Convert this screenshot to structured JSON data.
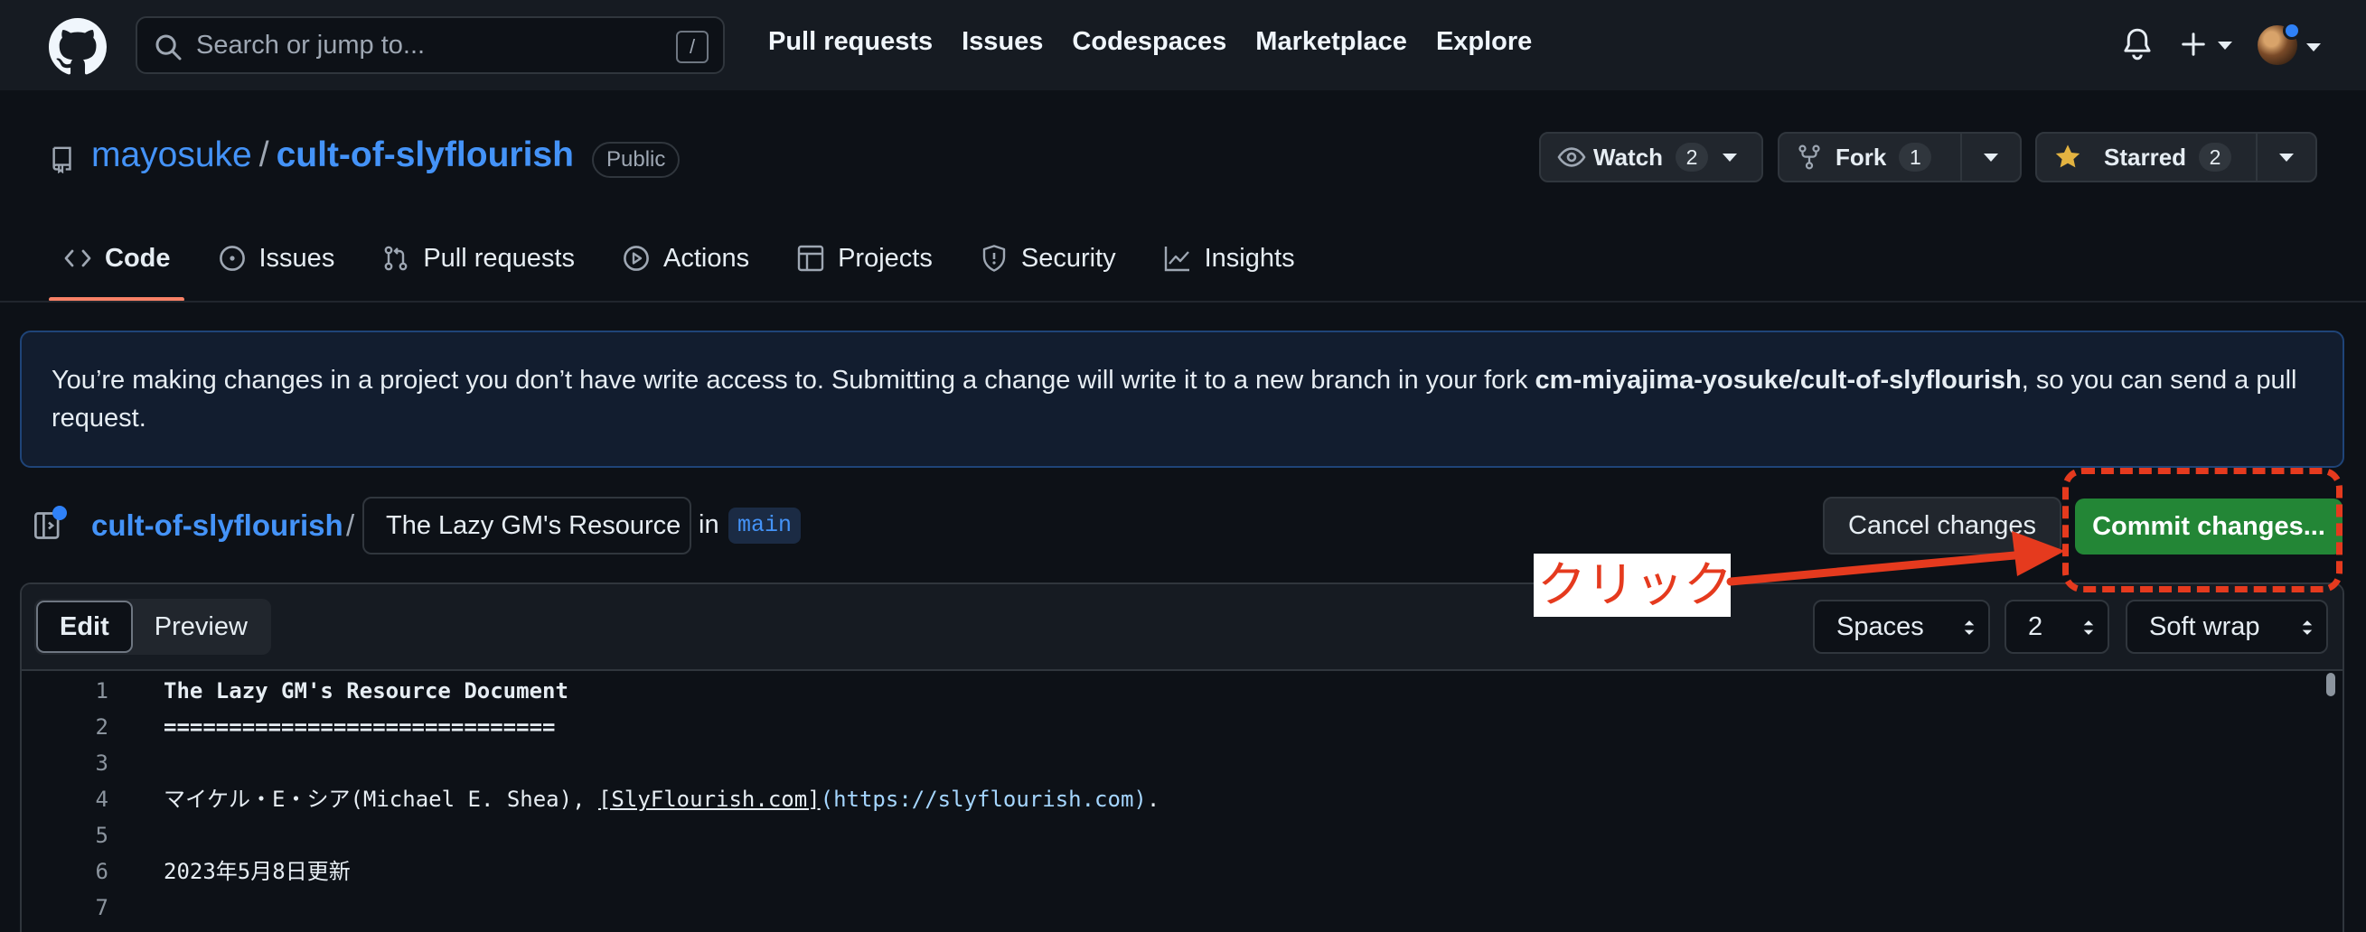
{
  "header": {
    "search_placeholder": "Search or jump to...",
    "search_shortcut": "/",
    "nav": [
      "Pull requests",
      "Issues",
      "Codespaces",
      "Marketplace",
      "Explore"
    ]
  },
  "repo": {
    "owner": "mayosuke",
    "separator": "/",
    "name": "cult-of-slyflourish",
    "visibility": "Public",
    "watch_label": "Watch",
    "watch_count": "2",
    "fork_label": "Fork",
    "fork_count": "1",
    "star_label": "Starred",
    "star_count": "2"
  },
  "tabs": [
    "Code",
    "Issues",
    "Pull requests",
    "Actions",
    "Projects",
    "Security",
    "Insights"
  ],
  "flash": {
    "text_before": "You’re making changes in a project you don’t have write access to. Submitting a change will write it to a new branch in your fork ",
    "fork_name": "cm-miyajima-yosuke/cult-of-slyflourish",
    "text_after": ", so you can send a pull request."
  },
  "file": {
    "repo": "cult-of-slyflourish",
    "separator": "/",
    "filename": "The Lazy GM's Resource",
    "in_label": "in",
    "branch": "main",
    "cancel_label": "Cancel changes",
    "commit_label": "Commit changes..."
  },
  "annotation": {
    "label": "クリック",
    "color": "#e53a1e"
  },
  "editor": {
    "edit_label": "Edit",
    "preview_label": "Preview",
    "indent_mode": "Spaces",
    "indent_size": "2",
    "wrap_mode": "Soft wrap",
    "lines": [
      {
        "n": "1",
        "text": "The Lazy GM's Resource Document"
      },
      {
        "n": "2",
        "text": "=============================="
      },
      {
        "n": "3",
        "text": ""
      },
      {
        "n": "4",
        "pre": "マイケル・E・シア(Michael E. Shea), ",
        "link": "[SlyFlourish.com]",
        "url": "(https://slyflourish.com)",
        "post": "."
      },
      {
        "n": "5",
        "text": ""
      },
      {
        "n": "6",
        "text": "2023年5月8日更新"
      },
      {
        "n": "7",
        "text": ""
      }
    ]
  },
  "colors": {
    "background": "#0d1117",
    "header": "#161b22",
    "link": "#4493f8",
    "commit_green": "#238636",
    "tab_underline": "#f78166"
  }
}
